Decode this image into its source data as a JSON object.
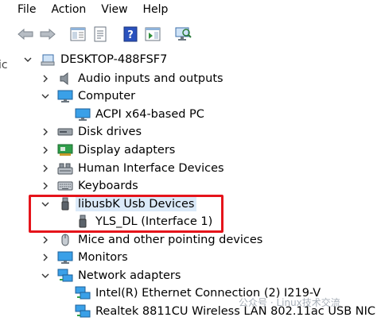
{
  "menu": [
    {
      "label": "File"
    },
    {
      "label": "Action"
    },
    {
      "label": "View"
    },
    {
      "label": "Help"
    }
  ],
  "left_edge_text": "ic",
  "tree": {
    "root": "DESKTOP-488FSF7",
    "nodes": [
      {
        "label": "Audio inputs and outputs",
        "expanded": false,
        "icon": "speaker-icon"
      },
      {
        "label": "Computer",
        "expanded": true,
        "icon": "monitor-icon"
      },
      {
        "label": "ACPI x64-based PC",
        "child": true,
        "icon": "monitor-icon"
      },
      {
        "label": "Disk drives",
        "expanded": false,
        "icon": "disk-drive-icon"
      },
      {
        "label": "Display adapters",
        "expanded": false,
        "icon": "display-adapter-icon"
      },
      {
        "label": "Human Interface Devices",
        "expanded": false,
        "icon": "hid-icon"
      },
      {
        "label": "Keyboards",
        "expanded": false,
        "icon": "keyboard-icon"
      },
      {
        "label": "libusbK Usb Devices",
        "expanded": true,
        "icon": "usb-icon"
      },
      {
        "label": "YLS_DL (Interface 1)",
        "child": true,
        "icon": "usb-icon"
      },
      {
        "label": "Mice and other pointing devices",
        "expanded": false,
        "icon": "mouse-icon"
      },
      {
        "label": "Monitors",
        "expanded": false,
        "icon": "monitor-icon"
      },
      {
        "label": "Network adapters",
        "expanded": true,
        "icon": "network-icon"
      },
      {
        "label": "Intel(R) Ethernet Connection (2) I219-V",
        "child": true,
        "icon": "network-icon"
      },
      {
        "label": "Realtek 8811CU Wireless LAN 802.11ac USB NIC",
        "child": true,
        "icon": "network-icon"
      }
    ]
  },
  "watermark": "公众号 · Linux技术交流",
  "colors": {
    "highlight": "#e5141b",
    "selection": "#dbeaf9"
  }
}
